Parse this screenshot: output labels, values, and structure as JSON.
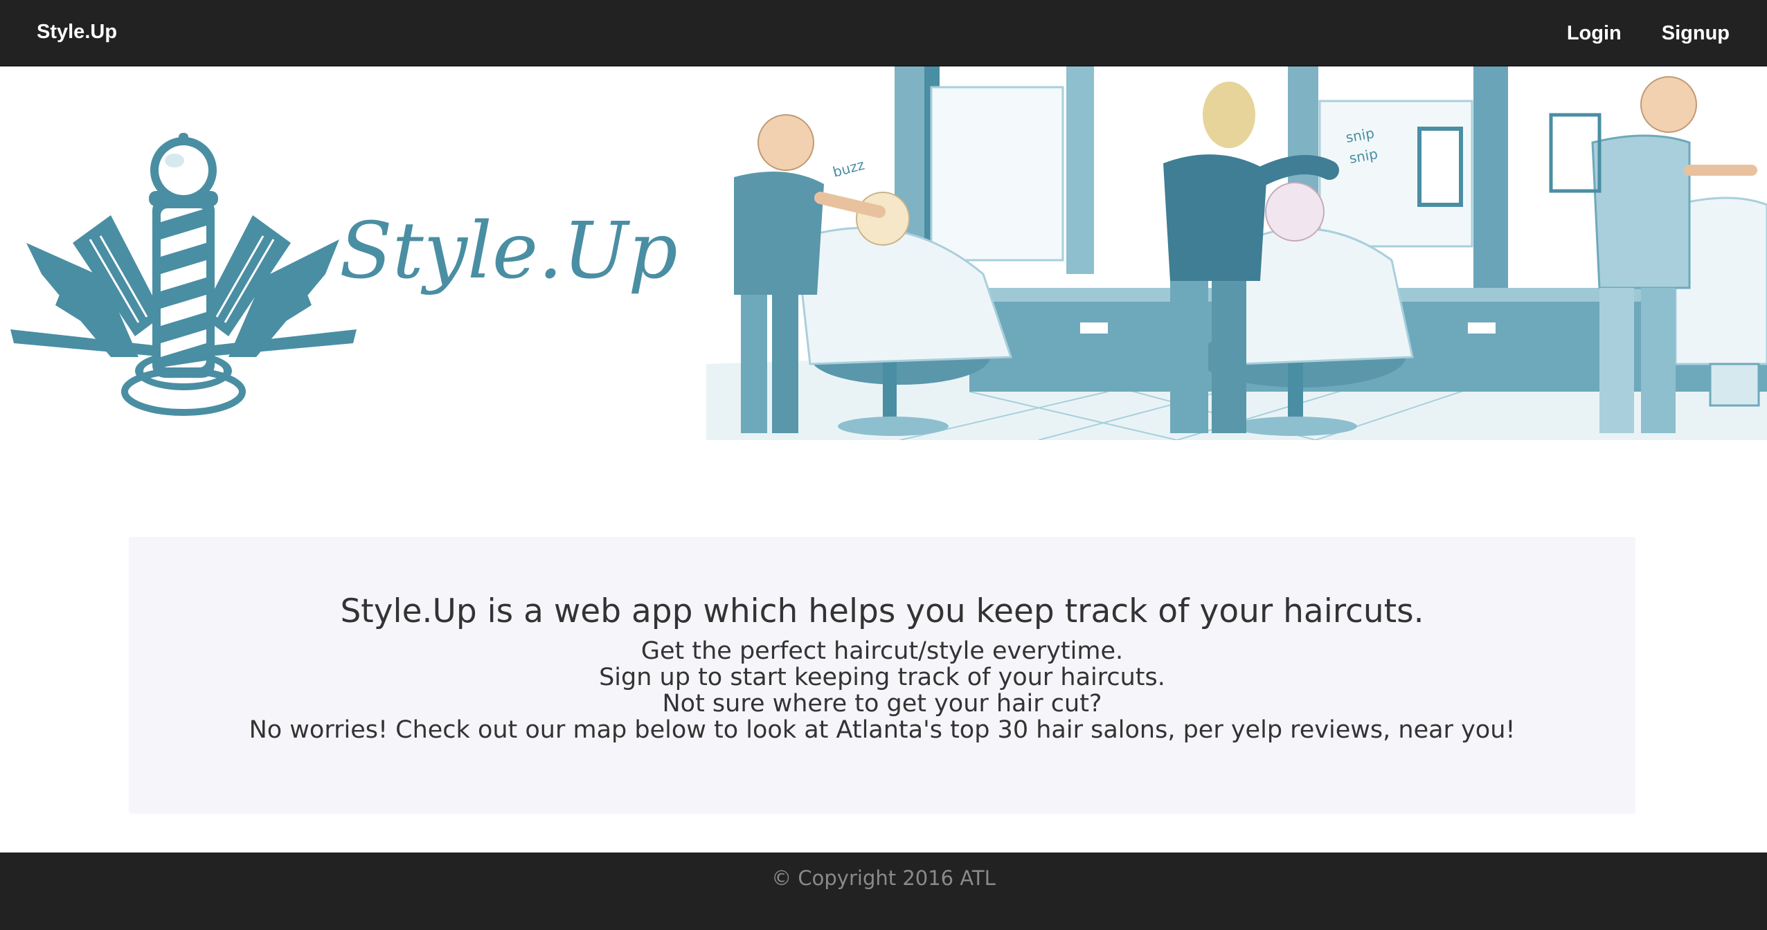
{
  "navbar": {
    "brand": "Style.Up",
    "links": [
      "Login",
      "Signup"
    ]
  },
  "banner": {
    "logo_text": "Style.Up",
    "illustration_labels": [
      "buzz",
      "snip",
      "snip"
    ],
    "colors": {
      "teal": "#4a8ea3",
      "light_teal": "#a9cfdc",
      "pale_teal": "#d6e9ef"
    }
  },
  "jumbotron": {
    "title": "Style.Up is a web app which helps you keep track of your haircuts.",
    "lines": [
      "Get the perfect haircut/style everytime.",
      "Sign up to start keeping track of your haircuts.",
      "Not sure where to get your hair cut?",
      "No worries! Check out our map below to look at Atlanta's top 30 hair salons, per yelp reviews, near you!"
    ]
  },
  "footer": {
    "copyright": "© Copyright 2016 ATL"
  }
}
